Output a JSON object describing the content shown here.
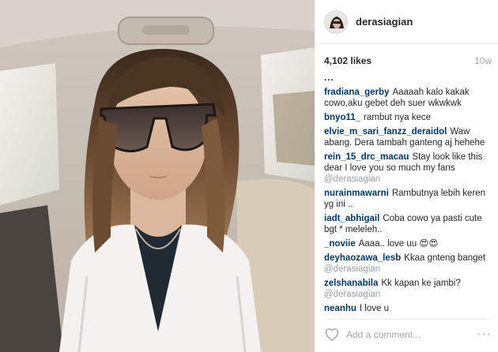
{
  "header": {
    "username": "derasiagian"
  },
  "stats": {
    "likes": "4,102 likes",
    "time": "10w"
  },
  "comments": {
    "more": "...",
    "items": [
      {
        "user": "fradiana_gerby",
        "text": "Aaaaah kalo kakak cowo,aku gebet deh suer wkwkwk",
        "mention": ""
      },
      {
        "user": "bnyo11_",
        "text": "rambut nya kece",
        "mention": ""
      },
      {
        "user": "elvie_m_sari_fanzz_deraidol",
        "text": "Waw abang. Dera tambah ganteng aj hehehe",
        "mention": ""
      },
      {
        "user": "rein_15_drc_macau",
        "text": "Stay look like this dear I love you so much my fans",
        "mention": "@derasiagian"
      },
      {
        "user": "nurainmawarni",
        "text": "Rambutnya lebih keren yg ini ..",
        "mention": ""
      },
      {
        "user": "iadt_abhigail",
        "text": "Coba cowo ya pasti cute bgt * meleleh..",
        "mention": ""
      },
      {
        "user": "_noviie",
        "text": "Aaaa.. love uu 😍😍",
        "mention": ""
      },
      {
        "user": "deyhaozawa_lesb",
        "text": "Kkaa gnteng banget",
        "mention": "@derasiagian"
      },
      {
        "user": "zelshanabila",
        "text": "Kk kapan ke jambi?",
        "mention": "@derasiagian"
      },
      {
        "user": "neanhu",
        "text": "I love u",
        "mention": ""
      }
    ]
  },
  "footer": {
    "comment_placeholder": "Add a comment...",
    "more_label": "···"
  },
  "icons": {
    "like": "heart-icon",
    "more": "more-options-icon"
  },
  "colors": {
    "username_link": "#003569",
    "muted": "#a5a7aa",
    "text": "#262626"
  }
}
